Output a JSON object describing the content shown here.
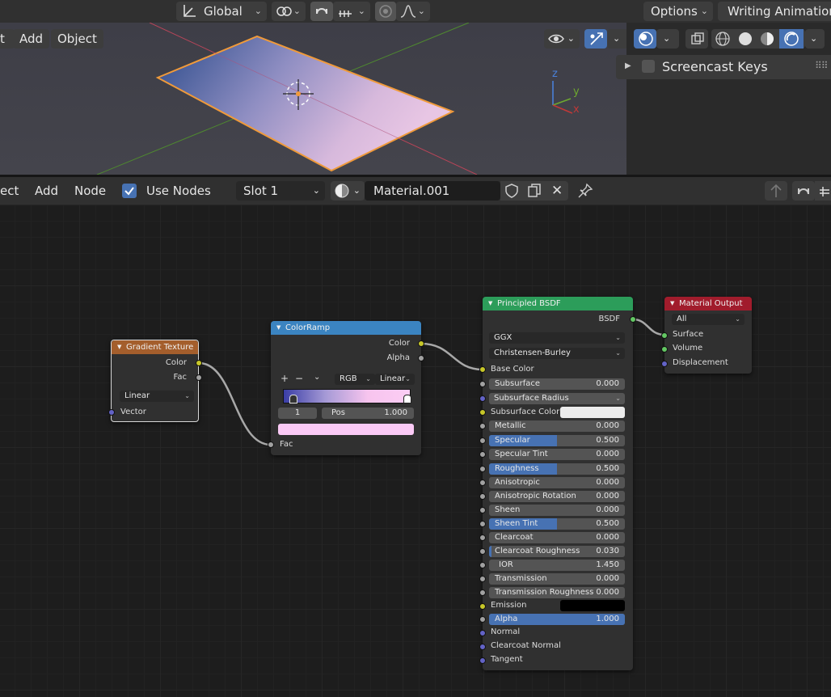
{
  "viewport_header": {
    "orientation": "Global",
    "options": "Options",
    "workspace": "Writing Animation"
  },
  "viewport_menu": {
    "add": "Add",
    "object": "Object",
    "partial": "t"
  },
  "side_panel": {
    "screencast_keys": "Screencast Keys"
  },
  "axes": {
    "z": "z",
    "y": "y",
    "x": "x"
  },
  "node_header": {
    "partial": "ect",
    "add": "Add",
    "node": "Node",
    "use_nodes": "Use Nodes",
    "slot": "Slot 1",
    "material": "Material.001"
  },
  "gradient_node": {
    "title": "Gradient Texture",
    "out_color": "Color",
    "out_fac": "Fac",
    "type": "Linear",
    "in_vector": "Vector"
  },
  "colorramp_node": {
    "title": "ColorRamp",
    "out_color": "Color",
    "out_alpha": "Alpha",
    "plus": "+",
    "minus": "−",
    "mode": "RGB",
    "interp": "Linear",
    "index": "1",
    "pos_label": "Pos",
    "pos_value": "1.000",
    "in_fac": "Fac"
  },
  "bsdf_node": {
    "title": "Principled BSDF",
    "out_bsdf": "BSDF",
    "distribution": "GGX",
    "subsurface_method": "Christensen-Burley",
    "base_color": "Base Color",
    "subsurface": {
      "label": "Subsurface",
      "value": "0.000",
      "fill": 0
    },
    "subsurface_radius": "Subsurface Radius",
    "subsurface_color": "Subsurface Color",
    "metallic": {
      "label": "Metallic",
      "value": "0.000",
      "fill": 0
    },
    "specular": {
      "label": "Specular",
      "value": "0.500",
      "fill": 0.5
    },
    "specular_tint": {
      "label": "Specular Tint",
      "value": "0.000",
      "fill": 0
    },
    "roughness": {
      "label": "Roughness",
      "value": "0.500",
      "fill": 0.5
    },
    "anisotropic": {
      "label": "Anisotropic",
      "value": "0.000",
      "fill": 0
    },
    "anisotropic_rotation": {
      "label": "Anisotropic Rotation",
      "value": "0.000",
      "fill": 0
    },
    "sheen": {
      "label": "Sheen",
      "value": "0.000",
      "fill": 0
    },
    "sheen_tint": {
      "label": "Sheen Tint",
      "value": "0.500",
      "fill": 0.5
    },
    "clearcoat": {
      "label": "Clearcoat",
      "value": "0.000",
      "fill": 0
    },
    "clearcoat_roughness": {
      "label": "Clearcoat Roughness",
      "value": "0.030",
      "fill": 0.03
    },
    "ior": {
      "label": "IOR",
      "value": "1.450",
      "fill": 0
    },
    "transmission": {
      "label": "Transmission",
      "value": "0.000",
      "fill": 0
    },
    "transmission_roughness": {
      "label": "Transmission Roughness",
      "value": "0.000",
      "fill": 0
    },
    "emission": "Emission",
    "alpha": {
      "label": "Alpha",
      "value": "1.000",
      "fill": 1
    },
    "normal": "Normal",
    "clearcoat_normal": "Clearcoat Normal",
    "tangent": "Tangent"
  },
  "output_node": {
    "title": "Material Output",
    "target": "All",
    "surface": "Surface",
    "volume": "Volume",
    "displacement": "Displacement"
  },
  "colors": {
    "accent": "#4772b3",
    "texture_header": "#a45e2c",
    "converter_header": "#3b84c1",
    "shader_header": "#2c9d5a",
    "output_header": "#a11c2c",
    "selected_outline": "#ff9f3a"
  }
}
